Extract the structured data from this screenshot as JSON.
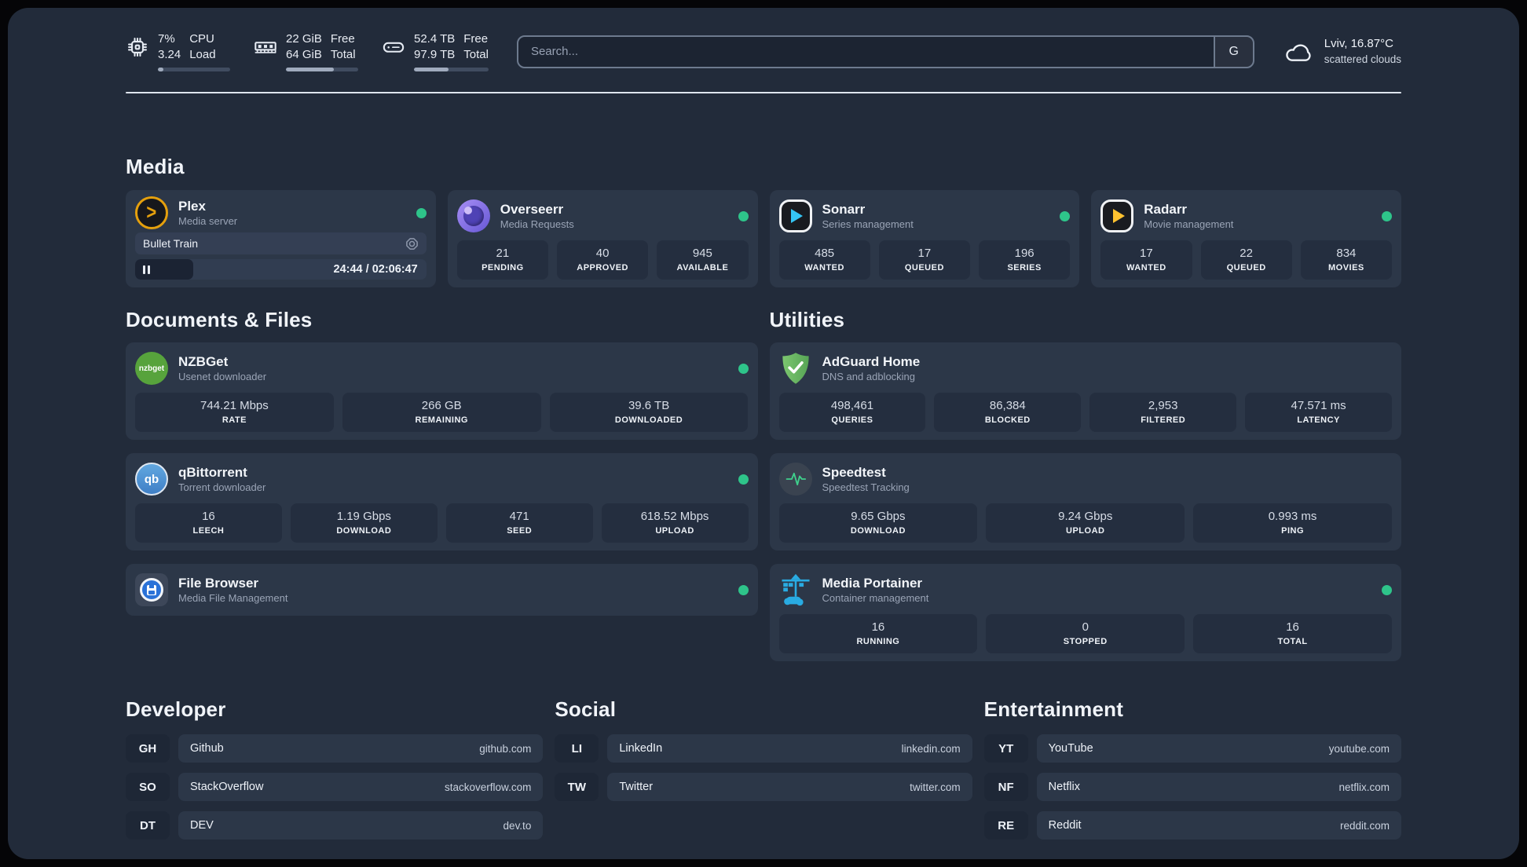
{
  "colors": {
    "background": "#222b3a",
    "card": "#2c3748",
    "stat_pill": "#242e3f",
    "status_online": "#2ec48a",
    "divider": "#dfe5ee",
    "plex_accent": "#e5a00d",
    "sonarr_accent": "#35c5f4",
    "radarr_accent": "#ffc230",
    "adguard_green": "#67b06c",
    "portainer_blue": "#29abe2"
  },
  "header": {
    "stats": [
      {
        "icon": "cpu-icon",
        "value_top": "7%",
        "value_bottom": "3.24",
        "label_top": "CPU",
        "label_bottom": "Load",
        "progress_pct": 8
      },
      {
        "icon": "ram-icon",
        "value_top": "22 GiB",
        "value_bottom": "64 GiB",
        "label_top": "Free",
        "label_bottom": "Total",
        "progress_pct": 66
      },
      {
        "icon": "disk-icon",
        "value_top": "52.4 TB",
        "value_bottom": "97.9 TB",
        "label_top": "Free",
        "label_bottom": "Total",
        "progress_pct": 46
      }
    ],
    "search": {
      "placeholder": "Search...",
      "button_label": "G"
    },
    "weather": {
      "icon": "cloud-icon",
      "location_temp": "Lviv, 16.87°C",
      "condition": "scattered clouds"
    }
  },
  "media": {
    "title": "Media",
    "apps": [
      {
        "icon": "plex-icon",
        "name": "Plex",
        "desc": "Media server",
        "online": true,
        "now_playing": {
          "title": "Bullet Train",
          "time": "24:44 / 02:06:47",
          "progress_pct": 20,
          "state": "paused"
        }
      },
      {
        "icon": "overseerr-icon",
        "name": "Overseerr",
        "desc": "Media Requests",
        "online": true,
        "stats": [
          {
            "value": "21",
            "label": "PENDING"
          },
          {
            "value": "40",
            "label": "APPROVED"
          },
          {
            "value": "945",
            "label": "AVAILABLE"
          }
        ]
      },
      {
        "icon": "sonarr-icon",
        "name": "Sonarr",
        "desc": "Series management",
        "online": true,
        "stats": [
          {
            "value": "485",
            "label": "WANTED"
          },
          {
            "value": "17",
            "label": "QUEUED"
          },
          {
            "value": "196",
            "label": "SERIES"
          }
        ]
      },
      {
        "icon": "radarr-icon",
        "name": "Radarr",
        "desc": "Movie management",
        "online": true,
        "stats": [
          {
            "value": "17",
            "label": "WANTED"
          },
          {
            "value": "22",
            "label": "QUEUED"
          },
          {
            "value": "834",
            "label": "MOVIES"
          }
        ]
      }
    ]
  },
  "documents": {
    "title": "Documents & Files",
    "apps": [
      {
        "icon": "nzbget-icon",
        "logo_text": "nzbget",
        "name": "NZBGet",
        "desc": "Usenet downloader",
        "online": true,
        "stats": [
          {
            "value": "744.21 Mbps",
            "label": "RATE"
          },
          {
            "value": "266 GB",
            "label": "REMAINING"
          },
          {
            "value": "39.6 TB",
            "label": "DOWNLOADED"
          }
        ]
      },
      {
        "icon": "qbittorrent-icon",
        "logo_text": "qb",
        "name": "qBittorrent",
        "desc": "Torrent downloader",
        "online": true,
        "stats": [
          {
            "value": "16",
            "label": "LEECH"
          },
          {
            "value": "1.19 Gbps",
            "label": "DOWNLOAD"
          },
          {
            "value": "471",
            "label": "SEED"
          },
          {
            "value": "618.52 Mbps",
            "label": "UPLOAD"
          }
        ]
      },
      {
        "icon": "filebrowser-icon",
        "name": "File Browser",
        "desc": "Media File Management",
        "online": true,
        "stats": []
      }
    ]
  },
  "utilities": {
    "title": "Utilities",
    "apps": [
      {
        "icon": "adguard-icon",
        "name": "AdGuard Home",
        "desc": "DNS and adblocking",
        "online": false,
        "stats": [
          {
            "value": "498,461",
            "label": "QUERIES"
          },
          {
            "value": "86,384",
            "label": "BLOCKED"
          },
          {
            "value": "2,953",
            "label": "FILTERED"
          },
          {
            "value": "47.571 ms",
            "label": "LATENCY"
          }
        ]
      },
      {
        "icon": "speedtest-icon",
        "name": "Speedtest",
        "desc": "Speedtest Tracking",
        "online": false,
        "stats": [
          {
            "value": "9.65 Gbps",
            "label": "DOWNLOAD"
          },
          {
            "value": "9.24 Gbps",
            "label": "UPLOAD"
          },
          {
            "value": "0.993 ms",
            "label": "PING"
          }
        ]
      },
      {
        "icon": "portainer-icon",
        "name": "Media Portainer",
        "desc": "Container management",
        "online": true,
        "stats": [
          {
            "value": "16",
            "label": "RUNNING"
          },
          {
            "value": "0",
            "label": "STOPPED"
          },
          {
            "value": "16",
            "label": "TOTAL"
          }
        ]
      }
    ]
  },
  "bookmarks": {
    "developer": {
      "title": "Developer",
      "items": [
        {
          "abbr": "GH",
          "name": "Github",
          "domain": "github.com"
        },
        {
          "abbr": "SO",
          "name": "StackOverflow",
          "domain": "stackoverflow.com"
        },
        {
          "abbr": "DT",
          "name": "DEV",
          "domain": "dev.to"
        }
      ]
    },
    "social": {
      "title": "Social",
      "items": [
        {
          "abbr": "LI",
          "name": "LinkedIn",
          "domain": "linkedin.com"
        },
        {
          "abbr": "TW",
          "name": "Twitter",
          "domain": "twitter.com"
        }
      ]
    },
    "entertainment": {
      "title": "Entertainment",
      "items": [
        {
          "abbr": "YT",
          "name": "YouTube",
          "domain": "youtube.com"
        },
        {
          "abbr": "NF",
          "name": "Netflix",
          "domain": "netflix.com"
        },
        {
          "abbr": "RE",
          "name": "Reddit",
          "domain": "reddit.com"
        }
      ]
    }
  }
}
